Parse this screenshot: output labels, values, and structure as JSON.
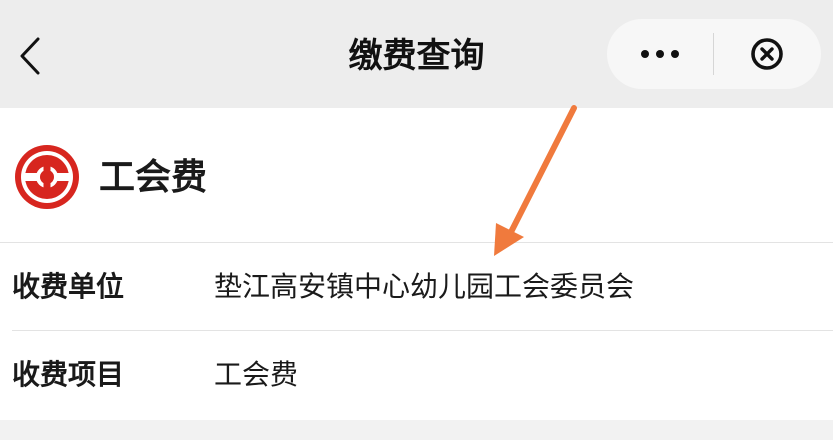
{
  "navbar": {
    "title": "缴费查询",
    "back_icon": "chevron-left-icon",
    "more_icon": "more-dots-icon",
    "close_icon": "circle-close-icon"
  },
  "card": {
    "logo_icon": "trade-union-logo-icon",
    "title": "工会费",
    "rows": [
      {
        "label": "收费单位",
        "value": "垫江高安镇中心幼儿园工会委员会"
      },
      {
        "label": "收费项目",
        "value": "工会费"
      }
    ]
  },
  "annotation": {
    "icon": "arrow-annotation-icon",
    "color": "#f07a3d"
  },
  "colors": {
    "logo_red": "#d7261f",
    "navbar_bg": "#ededed",
    "page_bg": "#f2f2f2"
  }
}
